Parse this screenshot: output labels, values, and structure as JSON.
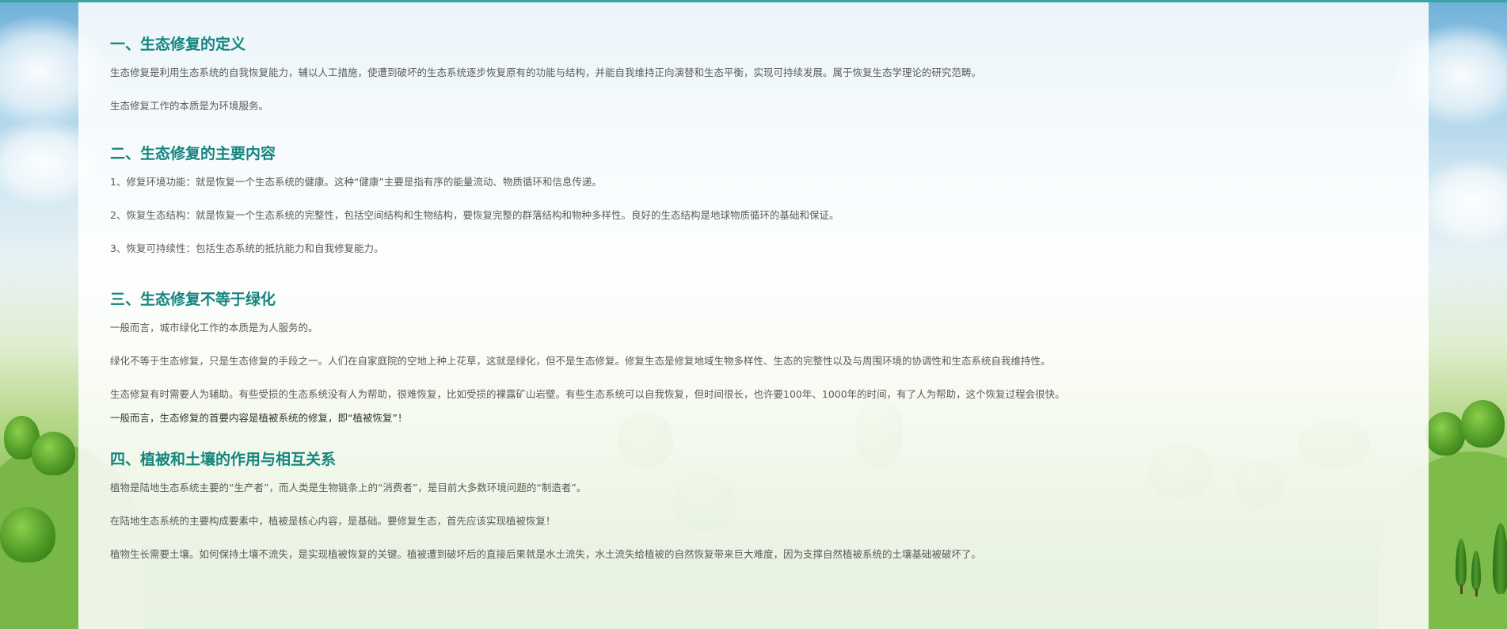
{
  "sections": [
    {
      "title": "一、生态修复的定义",
      "paragraphs": [
        "生态修复是利用生态系统的自我恢复能力，辅以人工措施，使遭到破坏的生态系统逐步恢复原有的功能与结构，并能自我维持正向演替和生态平衡，实现可持续发展。属于恢复生态学理论的研究范畴。",
        "生态修复工作的本质是为环境服务。"
      ]
    },
    {
      "title": "二、生态修复的主要内容",
      "paragraphs": [
        "1、修复环境功能：就是恢复一个生态系统的健康。这种“健康”主要是指有序的能量流动、物质循环和信息传递。",
        "2、恢复生态结构：就是恢复一个生态系统的完整性，包括空间结构和生物结构，要恢复完整的群落结构和物种多样性。良好的生态结构是地球物质循环的基础和保证。",
        "3、恢复可持续性：包括生态系统的抵抗能力和自我修复能力。"
      ]
    },
    {
      "title": "三、生态修复不等于绿化",
      "paragraphs": [
        "一般而言，城市绿化工作的本质是为人服务的。",
        "绿化不等于生态修复，只是生态修复的手段之一。人们在自家庭院的空地上种上花草，这就是绿化，但不是生态修复。修复生态是修复地域生物多样性、生态的完整性以及与周围环境的协调性和生态系统自我维持性。",
        "生态修复有时需要人为辅助。有些受损的生态系统没有人为帮助，很难恢复，比如受损的裸露矿山岩壁。有些生态系统可以自我恢复，但时间很长，也许要100年、1000年的时间，有了人为帮助，这个恢复过程会很快。",
        "一般而言，生态修复的首要内容是植被系统的修复，即“植被恢复”！"
      ]
    },
    {
      "title": "四、植被和土壤的作用与相互关系",
      "paragraphs": [
        "植物是陆地生态系统主要的“生产者”，而人类是生物链条上的“消费者”，是目前大多数环境问题的“制造者”。",
        "在陆地生态系统的主要构成要素中，植被是核心内容，是基础。要修复生态，首先应该实现植被恢复！",
        "植物生长需要土壤。如何保持土壤不流失，是实现植被恢复的关键。植被遭到破坏后的直接后果就是水土流失，水土流失给植被的自然恢复带来巨大难度，因为支撑自然植被系统的土壤基础被破坏了。"
      ]
    }
  ],
  "colors": {
    "heading": "#14857f",
    "body_text": "#5a5a5a",
    "accent_bar": "#3aa5a0"
  }
}
